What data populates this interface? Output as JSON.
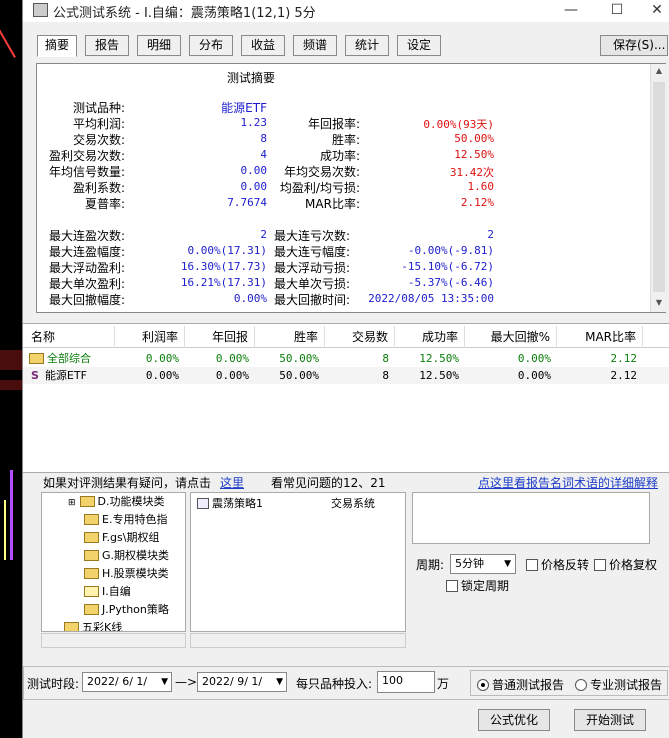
{
  "window": {
    "title": "公式测试系统 - I.自编：震荡策略1(12,1) 5分"
  },
  "tabs": [
    "摘要",
    "报告",
    "明细",
    "分布",
    "收益",
    "频谱",
    "统计",
    "设定"
  ],
  "save_label": "保存(S)...",
  "summary": {
    "title": "测试摘要",
    "variety_label": "测试品种:",
    "variety": "能源ETF",
    "left": [
      {
        "label": "平均利润:",
        "value": "1.23"
      },
      {
        "label": "交易次数:",
        "value": "8"
      },
      {
        "label": "盈利交易次数:",
        "value": "4"
      },
      {
        "label": "年均信号数量:",
        "value": "0.00"
      },
      {
        "label": "盈利系数:",
        "value": "0.00"
      },
      {
        "label": "夏普率:",
        "value": "7.7674"
      }
    ],
    "right": [
      {
        "label": "年回报率:",
        "value": "0.00%(93天)"
      },
      {
        "label": "胜率:",
        "value": "50.00%"
      },
      {
        "label": "成功率:",
        "value": "12.50%"
      },
      {
        "label": "年均交易次数:",
        "value": "31.42次"
      },
      {
        "label": "均盈利/均亏损:",
        "value": "1.60"
      },
      {
        "label": "MAR比率:",
        "value": "2.12%"
      }
    ],
    "left2": [
      {
        "label": "最大连盈次数:",
        "value": "2"
      },
      {
        "label": "最大连盈幅度:",
        "value": "0.00%(17.31)"
      },
      {
        "label": "最大浮动盈利:",
        "value": "16.30%(17.73)"
      },
      {
        "label": "最大单次盈利:",
        "value": "16.21%(17.31)"
      },
      {
        "label": "最大回撤幅度:",
        "value": "0.00%"
      }
    ],
    "right2": [
      {
        "label": "最大连亏次数:",
        "value": "2"
      },
      {
        "label": "最大连亏幅度:",
        "value": "-0.00%(-9.81)"
      },
      {
        "label": "最大浮动亏损:",
        "value": "-15.10%(-6.72)"
      },
      {
        "label": "最大单次亏损:",
        "value": "-5.37%(-6.46)"
      },
      {
        "label": "最大回撤时间:",
        "value": "2022/08/05 13:35:00"
      }
    ]
  },
  "table": {
    "headers": [
      "名称",
      "利润率",
      "年回报",
      "胜率",
      "交易数",
      "成功率",
      "最大回撤%",
      "MAR比率"
    ],
    "rows": [
      {
        "name": "全部综合",
        "cells": [
          "0.00%",
          "0.00%",
          "50.00%",
          "8",
          "12.50%",
          "0.00%",
          "2.12"
        ]
      },
      {
        "name": "能源ETF",
        "cells": [
          "0.00%",
          "0.00%",
          "50.00%",
          "8",
          "12.50%",
          "0.00%",
          "2.12"
        ]
      }
    ]
  },
  "hint": {
    "text1": "如果对评测结果有疑问，请点击",
    "link1": "这里",
    "text2": "看常见问题的12、21",
    "link2": "点这里看报告名词术语的详细解释"
  },
  "tree": [
    "D.功能模块类",
    "E.专用特色指",
    "F.gs\\期权组",
    "G.期权模块类",
    "H.股票模块类",
    "I.自编",
    "J.Python策略",
    "五彩K线"
  ],
  "list": {
    "name": "震荡策略1",
    "type": "交易系统"
  },
  "period": {
    "label": "周期:",
    "value": "5分钟",
    "opt1": "价格反转",
    "opt2": "价格复权",
    "opt3": "锁定周期"
  },
  "bottom": {
    "range_label": "测试时段:",
    "start": "2022/ 6/ 1/",
    "arrow": "—>",
    "end": "2022/ 9/ 1/",
    "invest_label": "每只品种投入:",
    "invest": "100",
    "unit": "万",
    "mode1": "普通测试报告",
    "mode2": "专业测试报告"
  },
  "buttons": {
    "optimize": "公式优化",
    "start": "开始测试"
  }
}
